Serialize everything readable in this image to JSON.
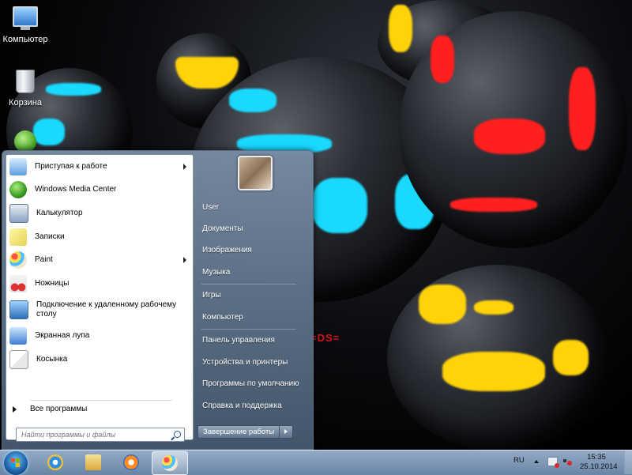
{
  "desktop": {
    "icons": [
      {
        "label": "Компьютер"
      },
      {
        "label": "Корзина"
      }
    ],
    "wallpaper_text": "=DS="
  },
  "start_menu": {
    "programs": [
      {
        "label": "Приступая к работе",
        "submenu": true
      },
      {
        "label": "Windows Media Center",
        "submenu": false
      },
      {
        "label": "Калькулятор",
        "submenu": false
      },
      {
        "label": "Записки",
        "submenu": false
      },
      {
        "label": "Paint",
        "submenu": true
      },
      {
        "label": "Ножницы",
        "submenu": false
      },
      {
        "label": "Подключение к удаленному рабочему столу",
        "line1": "Подключение к удаленному рабочему",
        "line2": "столу",
        "submenu": false
      },
      {
        "label": "Экранная лупа",
        "submenu": false
      },
      {
        "label": "Косынка",
        "submenu": false
      }
    ],
    "all_programs": "Все программы",
    "search": {
      "placeholder": "Найти программы и файлы"
    },
    "places": [
      "User",
      "Документы",
      "Изображения",
      "Музыка",
      "Игры",
      "Компьютер",
      "Панель управления",
      "Устройства и принтеры",
      "Программы по умолчанию",
      "Справка и поддержка"
    ],
    "shutdown_label": "Завершение работы"
  },
  "taskbar": {
    "pinned": [
      {
        "icon": "internet-explorer-icon"
      },
      {
        "icon": "explorer-folder-icon"
      },
      {
        "icon": "media-player-icon"
      },
      {
        "icon": "paint-icon",
        "active": true
      }
    ],
    "tray": {
      "language": "RU",
      "time": "15:35",
      "date": "25.10.2014"
    }
  },
  "colors": {
    "accent_blue": "#1a5fa6",
    "glow_cyan": "#19d9ff",
    "glow_yellow": "#ffd20a",
    "glow_red": "#ff1f1f"
  }
}
